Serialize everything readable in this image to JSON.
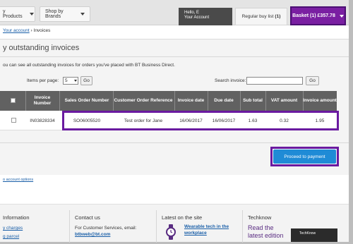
{
  "nav": {
    "products_label": "y Products",
    "brands_label": "Shop by Brands",
    "account_line1": "Hello, E",
    "account_line2": "Your Account",
    "buylist_label": "Regular buy list",
    "buylist_count": "(1)",
    "basket_label": "Basket (1) £357.78"
  },
  "breadcrumb": {
    "link": "Your account",
    "separator": "›",
    "current": "Invoices"
  },
  "page": {
    "title": "y outstanding invoices",
    "intro": "ou can see all outstanding invoices for orders you've placed with BT Business Direct."
  },
  "controls": {
    "items_per_page_label": "Items per page:",
    "items_per_page_value": "5",
    "go_label": "Go",
    "search_label": "Search invoice:",
    "search_value": ""
  },
  "table": {
    "headers": [
      "Invoice Number",
      "Sales Order Number",
      "Customer Order Reference",
      "Invoice date",
      "Due date",
      "Sub total",
      "VAT amount",
      "Invoice amount"
    ],
    "rows": [
      [
        "IN03828334",
        "SO06005520",
        "Test order for Jane",
        "16/06/2017",
        "16/06/2017",
        "1.63",
        "0.32",
        "1.95"
      ]
    ]
  },
  "proceed_label": "Proceed to payment",
  "account_options_link": "o account options",
  "footer": {
    "col1_heading": "Information",
    "col1_line1": "y charges",
    "col1_line2": "g parcel",
    "col2_heading": "Contact us",
    "col2_line1": "For Customer Services, email:",
    "col2_link": "btbweb@bt.com",
    "col3_heading": "Latest on the site",
    "col3_link_line1": "Wearable tech in the",
    "col3_link_line2": "workplace",
    "col4_heading": "Techknow",
    "col4_line1": "Read the",
    "col4_line2": "latest edition",
    "techknow_badge": "TechKnow"
  },
  "colors": {
    "accent": "#7a1fa2",
    "highlight": "#6a1aa0",
    "button": "#1f8bd6",
    "table_header": "#616161"
  }
}
